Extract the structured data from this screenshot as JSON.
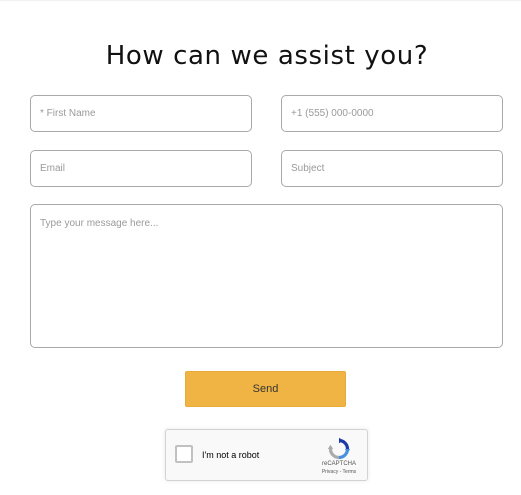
{
  "page": {
    "title": "How can we assist you?"
  },
  "form": {
    "first_name_placeholder": "* First Name",
    "phone_placeholder": "+1 (555) 000-0000",
    "email_placeholder": "Email",
    "subject_placeholder": "Subject",
    "message_placeholder": "Type your message here...",
    "send_label": "Send"
  },
  "recaptcha": {
    "label": "I'm not a robot",
    "brand": "reCAPTCHA",
    "terms": "Privacy - Terms",
    "logo_icon": "recaptcha-logo-icon"
  },
  "colors": {
    "send_button": "#f0b445",
    "field_border": "#a9a9a9",
    "placeholder": "#9a9a9a"
  }
}
